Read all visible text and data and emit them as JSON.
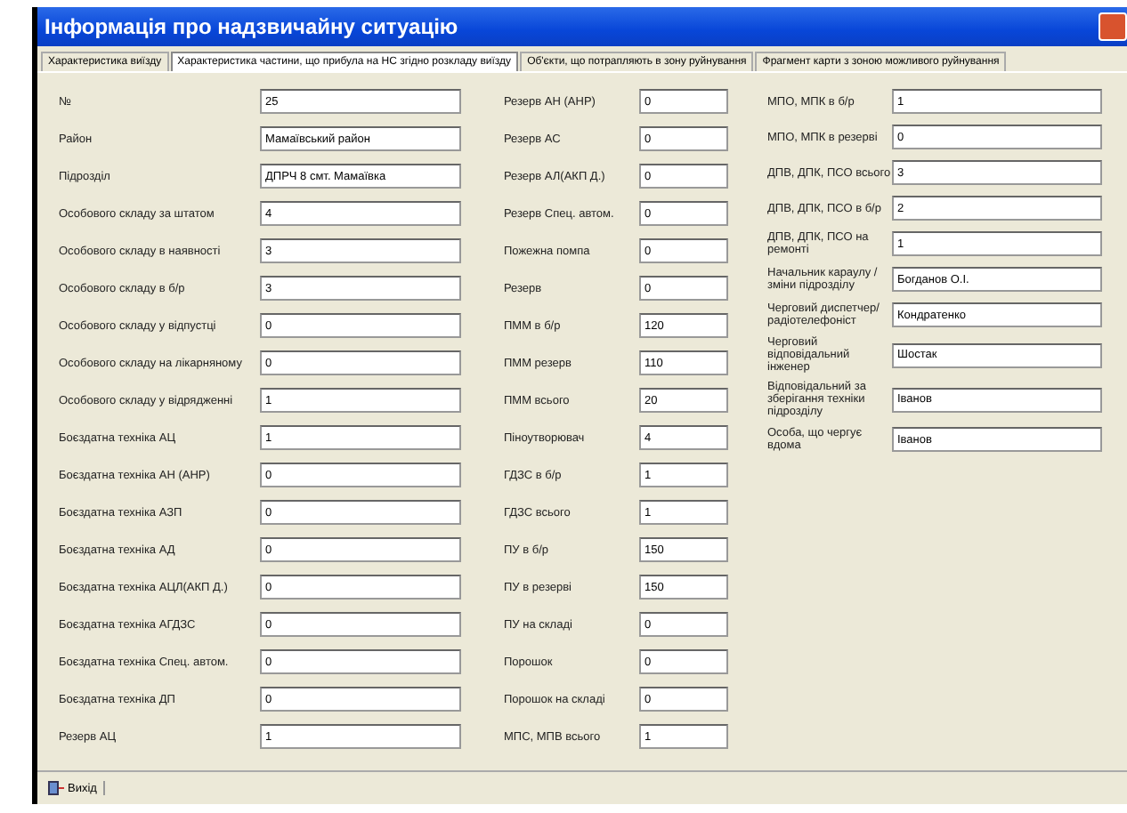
{
  "window": {
    "title": "Інформація про надзвичайну ситуацію"
  },
  "tabs": [
    {
      "label": "Характеристика виїзду",
      "selected": false
    },
    {
      "label": "Характеристика частини, що прибула на НС згідно розкладу виїзду",
      "selected": true
    },
    {
      "label": "Об'єкти, що потрапляють в зону руйнування",
      "selected": false
    },
    {
      "label": "Фрагмент карти з зоною можливого руйнування",
      "selected": false
    }
  ],
  "columns": [
    {
      "fields": [
        {
          "label": "№",
          "value": "25"
        },
        {
          "label": "Район",
          "value": "Мамаївський район"
        },
        {
          "label": "Підрозділ",
          "value": "ДПРЧ 8 смт. Мамаївка"
        },
        {
          "label": "Особового складу за штатом",
          "value": "4"
        },
        {
          "label": "Особового складу в наявності",
          "value": "3"
        },
        {
          "label": "Особового складу в б/р",
          "value": "3"
        },
        {
          "label": "Особового складу у відпустці",
          "value": "0"
        },
        {
          "label": "Особового складу на лікарняному",
          "value": "0"
        },
        {
          "label": "Особового складу у відрядженні",
          "value": "1"
        },
        {
          "label": "Боєздатна техніка АЦ",
          "value": "1"
        },
        {
          "label": "Боєздатна техніка АН (АНР)",
          "value": "0"
        },
        {
          "label": "Боєздатна техніка АЗП",
          "value": "0"
        },
        {
          "label": "Боєздатна техніка АД",
          "value": "0"
        },
        {
          "label": "Боєздатна техніка АЦЛ(АКП Д.)",
          "value": "0"
        },
        {
          "label": "Боєздатна техніка АГДЗС",
          "value": "0"
        },
        {
          "label": "Боєздатна техніка Спец. автом.",
          "value": "0"
        },
        {
          "label": "Боєздатна техніка ДП",
          "value": "0"
        },
        {
          "label": "Резерв АЦ",
          "value": "1"
        }
      ]
    },
    {
      "fields": [
        {
          "label": "Резерв АН (АНР)",
          "value": "0"
        },
        {
          "label": "Резерв АС",
          "value": "0"
        },
        {
          "label": "Резерв АЛ(АКП Д.)",
          "value": "0"
        },
        {
          "label": "Резерв Спец. автом.",
          "value": "0"
        },
        {
          "label": "Пожежна помпа",
          "value": "0"
        },
        {
          "label": "Резерв",
          "value": "0"
        },
        {
          "label": "ПММ в б/р",
          "value": "120"
        },
        {
          "label": "ПММ резерв",
          "value": "110"
        },
        {
          "label": "ПММ всього",
          "value": "20"
        },
        {
          "label": "Піноутворювач",
          "value": "4"
        },
        {
          "label": "ГДЗС в б/р",
          "value": "1"
        },
        {
          "label": "ГДЗС всього",
          "value": "1"
        },
        {
          "label": "ПУ в б/р",
          "value": "150"
        },
        {
          "label": "ПУ в резерві",
          "value": "150"
        },
        {
          "label": "ПУ на складі",
          "value": "0"
        },
        {
          "label": "Порошок",
          "value": "0"
        },
        {
          "label": "Порошок на складі",
          "value": "0"
        },
        {
          "label": "МПС, МПВ всього",
          "value": "1"
        }
      ]
    },
    {
      "fields": [
        {
          "label": "МПО, МПК в б/р",
          "value": "1"
        },
        {
          "label": "МПО, МПК в резерві",
          "value": "0"
        },
        {
          "label": "ДПВ, ДПК, ПСО всього",
          "value": "3"
        },
        {
          "label": "ДПВ, ДПК, ПСО в б/р",
          "value": "2"
        },
        {
          "label": "ДПВ, ДПК, ПСО на ремонті",
          "value": "1"
        },
        {
          "label": "Начальник караулу / зміни підрозділу",
          "value": "Богданов О.І."
        },
        {
          "label": "Черговий диспетчер/ радіотелефоніст",
          "value": "Кондратенко"
        },
        {
          "label": "Черговий відповідальний інженер",
          "value": "Шостак"
        },
        {
          "label": "Відповідальний за зберігання техніки підрозділу",
          "value": "Іванов"
        },
        {
          "label": "Особа, що чергує вдома",
          "value": "Іванов"
        }
      ]
    }
  ],
  "exit_button": {
    "label": "Вихід"
  }
}
